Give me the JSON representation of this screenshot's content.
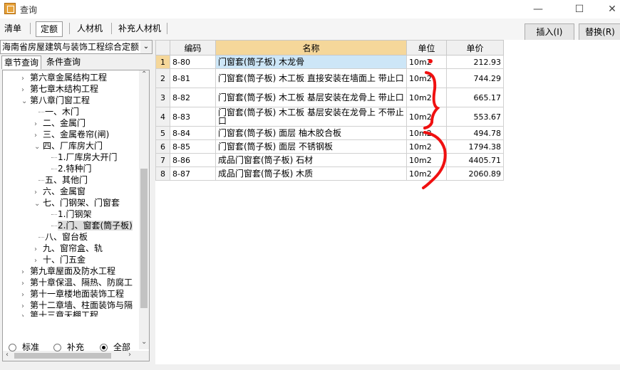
{
  "window": {
    "title": "查询",
    "minimize": "—",
    "maximize": "☐",
    "close": "✕"
  },
  "toolbar": {
    "tabs": [
      "清单",
      "定额",
      "人材机",
      "补充人材机"
    ],
    "insert_label": "插入(I)",
    "replace_label": "替换(R)"
  },
  "left": {
    "library": "海南省房屋建筑与装饰工程综合定额",
    "tabs": [
      "章节查询",
      "条件查询"
    ],
    "tree": [
      {
        "label": "第六章金属结构工程"
      },
      {
        "label": "第七章木结构工程"
      },
      {
        "label": "第八章门窗工程"
      },
      {
        "label": "一、木门"
      },
      {
        "label": "二、金属门"
      },
      {
        "label": "三、金属卷帘(闸)"
      },
      {
        "label": "四、厂库房大门"
      },
      {
        "label": "1.厂库房大开门"
      },
      {
        "label": "2.特种门"
      },
      {
        "label": "五、其他门"
      },
      {
        "label": "六、金属窗"
      },
      {
        "label": "七、门钢架、门窗套"
      },
      {
        "label": "1.门钢架"
      },
      {
        "label": "2.门、窗套(筒子板)"
      },
      {
        "label": "八、窗台板"
      },
      {
        "label": "九、窗帘盒、轨"
      },
      {
        "label": "十、门五金"
      },
      {
        "label": "第九章屋面及防水工程"
      },
      {
        "label": "第十章保温、隔热、防腐工"
      },
      {
        "label": "第十一章楼地面装饰工程"
      },
      {
        "label": "第十二章墙、柱面装饰与隔"
      },
      {
        "label": "第十三章天棚工程"
      }
    ],
    "radios": [
      "标准",
      "补充",
      "全部"
    ],
    "radio_selected": "全部"
  },
  "grid": {
    "columns": [
      "",
      "编码",
      "名称",
      "单位",
      "单价"
    ],
    "rows": [
      {
        "n": "1",
        "code": "8-80",
        "name": "门窗套(筒子板) 木龙骨",
        "unit": "10m2",
        "price": "212.93"
      },
      {
        "n": "2",
        "code": "8-81",
        "name": "门窗套(筒子板) 木工板 直接安装在墙面上 带止口",
        "unit": "10m2",
        "price": "744.29"
      },
      {
        "n": "3",
        "code": "8-82",
        "name": "门窗套(筒子板) 木工板 基层安装在龙骨上 带止口",
        "unit": "10m2",
        "price": "665.17"
      },
      {
        "n": "4",
        "code": "8-83",
        "name": "门窗套(筒子板) 木工板 基层安装在龙骨上 不带止口",
        "unit": "10m2",
        "price": "553.67"
      },
      {
        "n": "5",
        "code": "8-84",
        "name": "门窗套(筒子板) 面层 柚木胶合板",
        "unit": "10m2",
        "price": "494.78"
      },
      {
        "n": "6",
        "code": "8-85",
        "name": "门窗套(筒子板) 面层 不锈钢板",
        "unit": "10m2",
        "price": "1794.38"
      },
      {
        "n": "7",
        "code": "8-86",
        "name": "成品门窗套(筒子板) 石材",
        "unit": "10m2",
        "price": "4405.71"
      },
      {
        "n": "8",
        "code": "8-87",
        "name": "成品门窗套(筒子板) 木质",
        "unit": "10m2",
        "price": "2060.89"
      }
    ]
  }
}
